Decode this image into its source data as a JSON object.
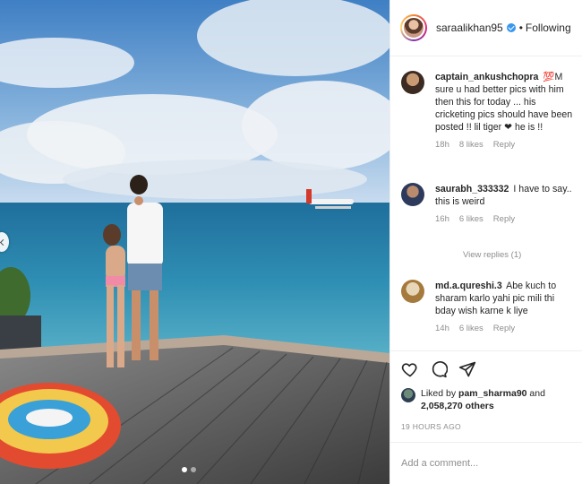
{
  "header": {
    "username": "saraalikhan95",
    "separator": "•",
    "follow_status": "Following"
  },
  "comments": [
    {
      "username": "captain_ankushchopra",
      "text": "💯M sure u had better pics with him then this for today ... his cricketing pics should have been posted !! lil tiger ❤ he is !!",
      "time": "18h",
      "likes": "8 likes",
      "reply": "Reply"
    },
    {
      "username": "saurabh_333332",
      "text": "I have to say.. this is weird",
      "time": "16h",
      "likes": "6 likes",
      "reply": "Reply",
      "view_replies": "View replies (1)"
    },
    {
      "username": "md.a.qureshi.3",
      "text": "Abe kuch to sharam karlo yahi pic mili thi bday wish karne k liye",
      "time": "14h",
      "likes": "6 likes",
      "reply": "Reply"
    }
  ],
  "likes": {
    "prefix": "Liked by",
    "user": "pam_sharma90",
    "and": "and",
    "count": "2,058,270 others"
  },
  "timestamp": "19 HOURS AGO",
  "add_comment": {
    "placeholder": "Add a comment..."
  },
  "carousel": {
    "slides": 2,
    "active_index": 0
  },
  "icons": [
    "heart-icon",
    "comment-icon",
    "share-icon",
    "verified-badge-icon"
  ],
  "colors": {
    "verified": "#3897f0",
    "muted": "#8e8e8e",
    "text": "#262626"
  }
}
